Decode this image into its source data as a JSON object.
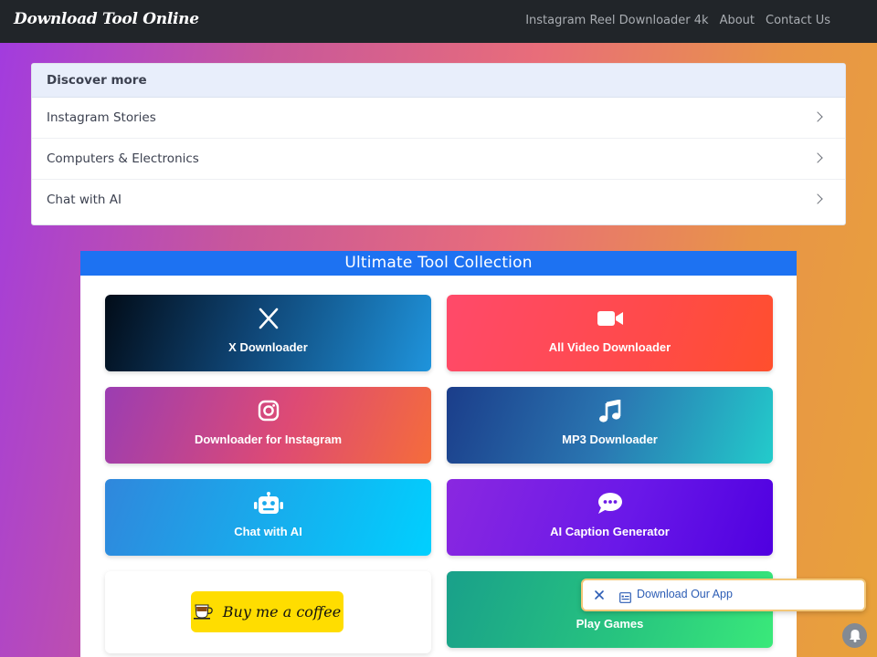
{
  "navbar": {
    "brand": "Download Tool Online",
    "links": [
      "Instagram Reel Downloader 4k",
      "About",
      "Contact Us"
    ]
  },
  "discover": {
    "heading": "Discover more",
    "items": [
      "Instagram Stories",
      "Computers & Electronics",
      "Chat with AI"
    ]
  },
  "tools": {
    "heading": "Ultimate Tool Collection",
    "tiles": [
      {
        "label": "X Downloader",
        "icon": "x-logo-icon"
      },
      {
        "label": "All Video Downloader",
        "icon": "video-camera-icon"
      },
      {
        "label": "Downloader for Instagram",
        "icon": "instagram-icon"
      },
      {
        "label": "MP3 Downloader",
        "icon": "music-note-icon"
      },
      {
        "label": "Chat with AI",
        "icon": "robot-icon"
      },
      {
        "label": "AI Caption Generator",
        "icon": "chat-bubble-icon"
      },
      {
        "label": "Buy me a coffee",
        "icon": "coffee-cup-icon"
      },
      {
        "label": "Play Games",
        "icon": "gamepad-icon"
      }
    ]
  },
  "app_popup": {
    "label": "Download Our App",
    "border_color": "#f3c778"
  },
  "colors": {
    "navbar": "#212529",
    "tools_header": "#1d72f2",
    "coffee_button": "#ffdd00"
  }
}
